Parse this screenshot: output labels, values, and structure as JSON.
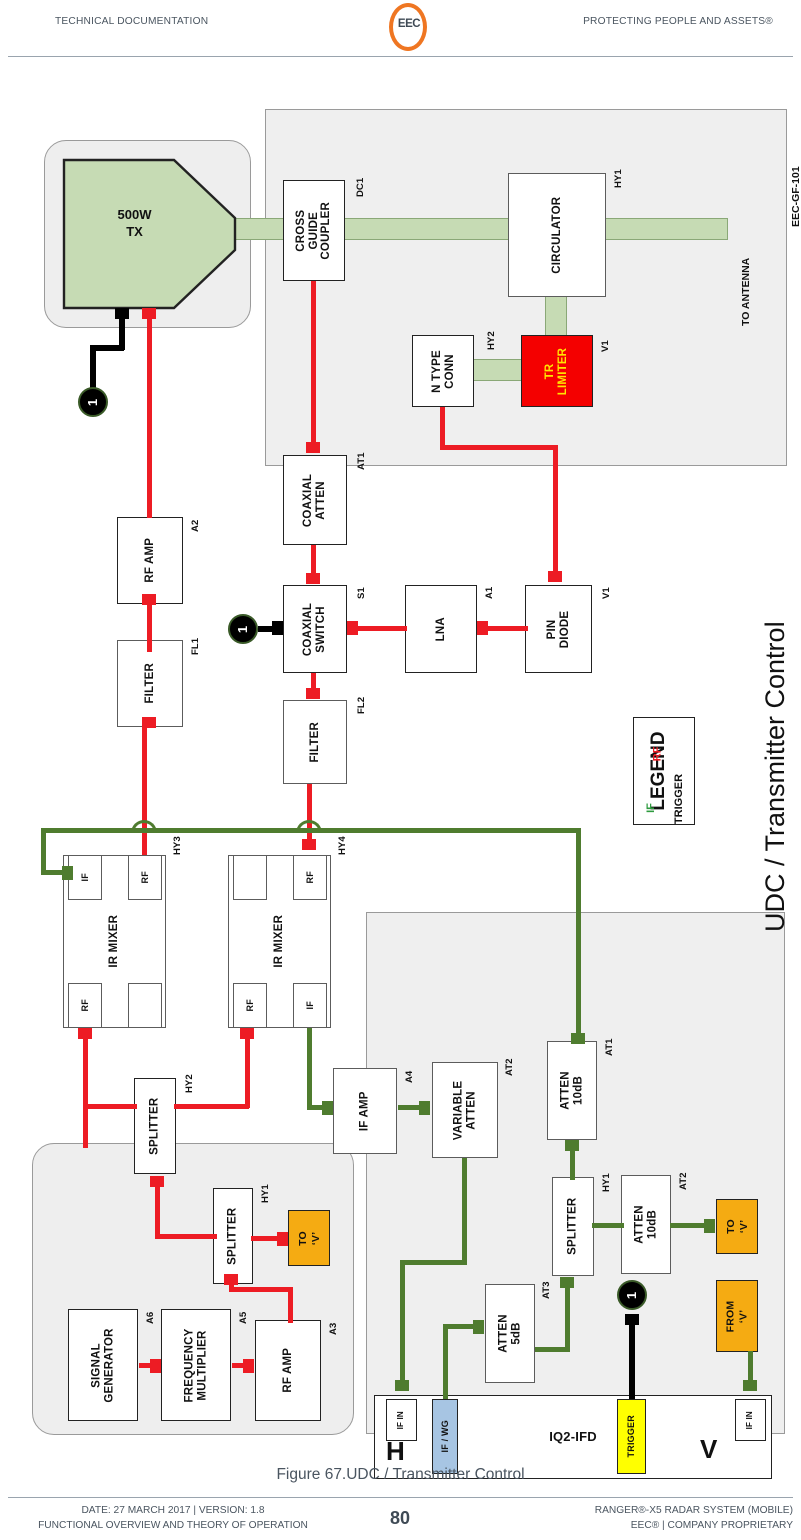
{
  "header": {
    "left": "TECHNICAL DOCUMENTATION",
    "right": "PROTECTING PEOPLE AND ASSETS®",
    "logo_text": "EEC"
  },
  "footer": {
    "caption": "Figure 67.UDC / Transmitter Control",
    "left_line1": "DATE: 27 MARCH 2017 | VERSION: 1.8",
    "left_line2": "FUNCTIONAL OVERVIEW AND THEORY OF OPERATION",
    "page_number": "80",
    "right_line1": "RANGER®-X5 RADAR SYSTEM (MOBILE)",
    "right_line2": "EEC® | COMPANY PROPRIETARY"
  },
  "figure": {
    "title": "UDC / Transmitter Control",
    "doc_code": "EEC-GF-101",
    "to_antenna": "TO ANTENNA"
  },
  "legend": {
    "title": "LEGEND",
    "rf": "RF",
    "if": "IF",
    "trigger": "TRIGGER",
    "rf_color": "#ed1c24",
    "if_color": "#2e9b3f",
    "trigger_color": "#000000"
  },
  "blocks": {
    "tx": {
      "label": "500W\nTX"
    },
    "cross_guide": {
      "label": "CROSS\nGUIDE\nCOUPLER",
      "ref": "DC1"
    },
    "circulator": {
      "label": "CIRCULATOR",
      "ref": "HY1"
    },
    "n_type_conn": {
      "label": "N TYPE\nCONN",
      "ref": "HY2"
    },
    "tr_limiter": {
      "label": "TR\nLIMITER",
      "ref": "V1"
    },
    "coaxial_atten": {
      "label": "COAXIAL\nATTEN",
      "ref": "AT1"
    },
    "coaxial_switch": {
      "label": "COAXIAL\nSWITCH",
      "ref": "S1"
    },
    "lna": {
      "label": "LNA",
      "ref": "A1"
    },
    "pin_diode": {
      "label": "PIN\nDIODE",
      "ref": "V1"
    },
    "rf_amp_a2": {
      "label": "RF AMP",
      "ref": "A2"
    },
    "filter_fl1": {
      "label": "FILTER",
      "ref": "FL1"
    },
    "filter_fl2": {
      "label": "FILTER",
      "ref": "FL2"
    },
    "ir_mixer_hy3": {
      "label": "IR MIXER",
      "ref": "HY3",
      "port_if": "IF",
      "port_rf_top": "RF",
      "port_rf_bot": "RF"
    },
    "ir_mixer_hy4": {
      "label": "IR MIXER",
      "ref": "HY4",
      "port_if": "IF",
      "port_rf_top": "RF",
      "port_rf_bot": "RF"
    },
    "splitter_hy2": {
      "label": "SPLITTER",
      "ref": "HY2"
    },
    "splitter_hy1_l": {
      "label": "SPLITTER",
      "ref": "HY1"
    },
    "to_v_left": {
      "label": "TO\n‘V’"
    },
    "signal_gen": {
      "label": "SIGNAL\nGENERATOR",
      "ref": "A6"
    },
    "freq_mult": {
      "label": "FREQUENCY\nMULTIPLIER",
      "ref": "A5"
    },
    "rf_amp_a3": {
      "label": "RF AMP",
      "ref": "A3"
    },
    "if_amp": {
      "label": "IF AMP",
      "ref": "A4"
    },
    "variable_atten": {
      "label": "VARIABLE\nATTEN",
      "ref": "AT2"
    },
    "atten_10db_at1": {
      "label": "ATTEN\n10dB",
      "ref": "AT1"
    },
    "splitter_hy1_r": {
      "label": "SPLITTER",
      "ref": "HY1"
    },
    "atten_10db_at2": {
      "label": "ATTEN\n10dB",
      "ref": "AT2"
    },
    "atten_5db_at3": {
      "label": "ATTEN\n5dB",
      "ref": "AT3"
    },
    "to_v_right": {
      "label": "TO\n‘V’"
    },
    "from_v": {
      "label": "FROM\n‘V’"
    },
    "iq2ifd": {
      "label": "IQ2-IFD",
      "if_in_h": "IF IN",
      "if_wg": "IF / WG",
      "trigger": "TRIGGER",
      "if_in_v": "IF IN",
      "pol_h": "H",
      "pol_v": "V"
    }
  },
  "markers": {
    "one": "1"
  },
  "colors": {
    "rf_red": "#ed1c24",
    "if_green": "#4f7c2f",
    "trigger_black": "#000000",
    "waveguide": "#c6dbb4",
    "panel_gray": "#efefef",
    "tr_limiter_bg": "#f40000",
    "tr_limiter_fg": "#ffe400",
    "to_from_v_bg": "#f5ab12",
    "trigger_bg": "#ffff00",
    "if_wg_bg": "#a7c5e3",
    "logo_orange": "#ef7622"
  }
}
